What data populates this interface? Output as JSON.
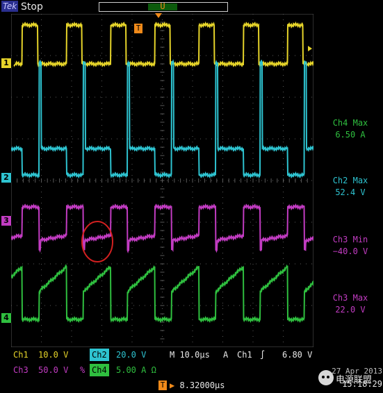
{
  "header": {
    "logo": "Tek",
    "run_state": "Stop",
    "trigger_pos_label": "U"
  },
  "markers": {
    "ch1": "1",
    "ch2": "2",
    "ch3": "3",
    "ch4": "4"
  },
  "measurements": [
    {
      "label": "Ch4 Max",
      "value": "6.50 A",
      "color": "#2fbf3f"
    },
    {
      "label": "Ch2 Max",
      "value": "52.4 V",
      "color": "#2ec3d0"
    },
    {
      "label": "Ch3 Min",
      "value": "−40.0 V",
      "color": "#c23cc2"
    },
    {
      "label": "Ch3 Max",
      "value": "22.0 V",
      "color": "#c23cc2"
    }
  ],
  "settings": {
    "ch1_label": "Ch1",
    "ch1_scale": "10.0 V",
    "ch2_label": "Ch2",
    "ch2_scale": "20.0 V",
    "timebase": "M 10.0µs",
    "trig_mode": "A",
    "trig_source": "Ch1",
    "trig_slope": "∫",
    "trig_level": "6.80 V",
    "ch3_label": "Ch3",
    "ch3_scale": "50.0 V",
    "ch3_bw": "%",
    "ch4_label": "Ch4",
    "ch4_scale": "5.00 A Ω",
    "trig_offset": "8.32000µs",
    "date": "27 Apr 2013",
    "time": "15:18:29"
  },
  "watermark": {
    "text": "电源联盟"
  },
  "colors": {
    "ch1": "#e6d42a",
    "ch2": "#2ec3d0",
    "ch3": "#c23cc2",
    "ch4": "#2fbf3f",
    "grid": "#5a5a5a",
    "annotation": "#d22020"
  }
}
